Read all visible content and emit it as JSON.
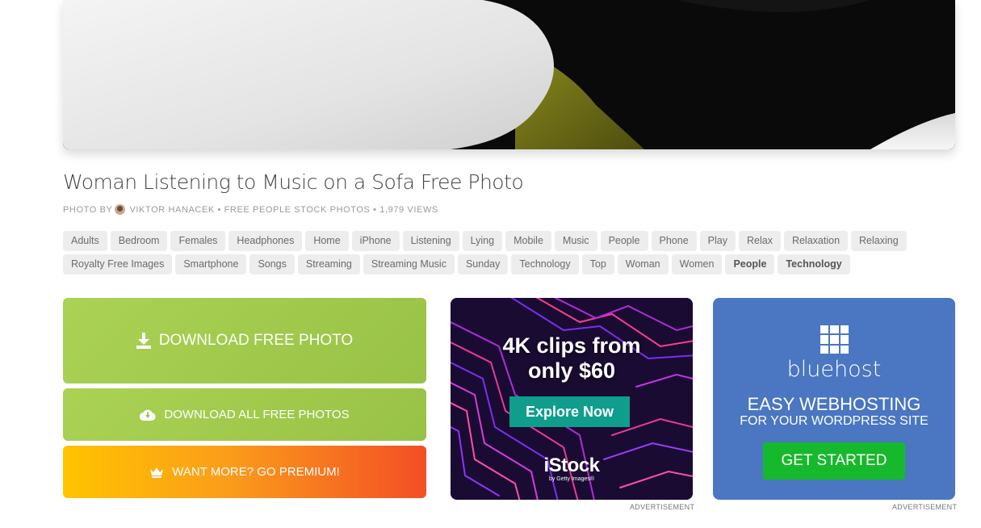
{
  "photo": {
    "alt": "Woman Listening to Music on a Sofa"
  },
  "title": "Woman Listening to Music on a Sofa Free Photo",
  "meta": {
    "photo_by": "PHOTO BY",
    "author": "VIKTOR HANACEK",
    "separator1": "•",
    "category": "FREE PEOPLE STOCK PHOTOS",
    "separator2": "•",
    "views": "1,979 VIEWS"
  },
  "tags": [
    {
      "label": "Adults"
    },
    {
      "label": "Bedroom"
    },
    {
      "label": "Females"
    },
    {
      "label": "Headphones"
    },
    {
      "label": "Home"
    },
    {
      "label": "iPhone"
    },
    {
      "label": "Listening"
    },
    {
      "label": "Lying"
    },
    {
      "label": "Mobile"
    },
    {
      "label": "Music"
    },
    {
      "label": "People"
    },
    {
      "label": "Phone"
    },
    {
      "label": "Play"
    },
    {
      "label": "Relax"
    },
    {
      "label": "Relaxation"
    },
    {
      "label": "Relaxing"
    },
    {
      "label": "Royalty Free Images"
    },
    {
      "label": "Smartphone"
    },
    {
      "label": "Songs"
    },
    {
      "label": "Streaming"
    },
    {
      "label": "Streaming Music"
    },
    {
      "label": "Sunday"
    },
    {
      "label": "Technology"
    },
    {
      "label": "Top"
    },
    {
      "label": "Woman"
    },
    {
      "label": "Women"
    },
    {
      "label": "People",
      "bold": true
    },
    {
      "label": "Technology",
      "bold": true
    }
  ],
  "buttons": {
    "download": "DOWNLOAD FREE PHOTO",
    "download_all": "DOWNLOAD ALL FREE PHOTOS",
    "premium": "WANT MORE? GO PREMIUM!"
  },
  "ads": {
    "istock": {
      "headline_line1": "4K clips from",
      "headline_line2": "only $60",
      "cta": "Explore Now",
      "brand": "iStock",
      "brand_sub": "by Getty Images®",
      "label": "ADVERTISEMENT"
    },
    "bluehost": {
      "brand": "bluehost",
      "headline": "EASY WEBHOSTING",
      "subheadline": "FOR YOUR WORDPRESS SITE",
      "cta": "GET STARTED",
      "label": "ADVERTISEMENT"
    }
  },
  "colors": {
    "download_green": "#a6cd4f",
    "premium_start": "#ffc400",
    "premium_end": "#f34e25",
    "bluehost_blue": "#4a76c2",
    "bluehost_cta": "#16b92c",
    "istock_cta": "#0f9d8c"
  },
  "icons": {
    "download": "download-icon",
    "cloud_download": "cloud-download-icon",
    "premium": "crown-icon",
    "bluehost_logo": "grid-logo-icon"
  }
}
